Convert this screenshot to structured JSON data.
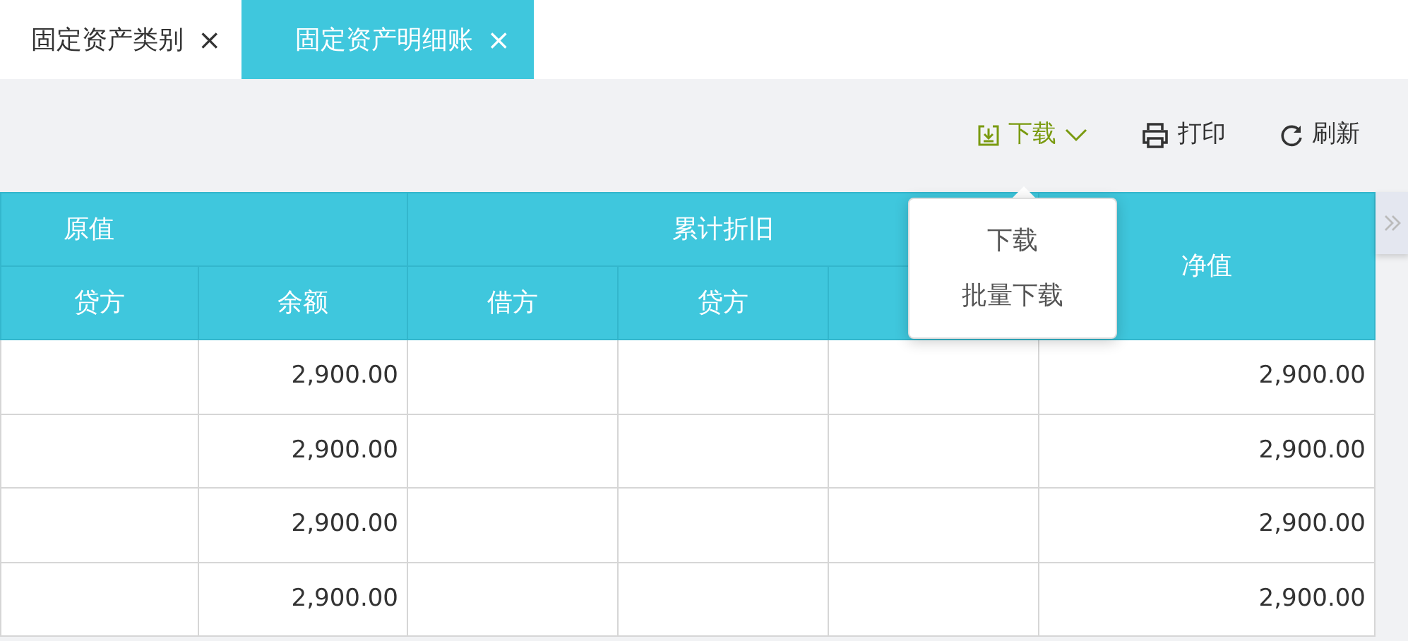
{
  "tabs": [
    {
      "label": "固定资产类别",
      "close": "×",
      "selected": false
    },
    {
      "label": "固定资产明细账",
      "close": "×",
      "selected": true
    }
  ],
  "toolbar": [
    {
      "kind": "download",
      "label": "下载",
      "expanded": true
    },
    {
      "kind": "print",
      "label": "打印"
    },
    {
      "kind": "refresh",
      "label": "刷新"
    }
  ],
  "dropdown": {
    "items": [
      "下载",
      "批量下载"
    ]
  },
  "table": {
    "group_headers": [
      "原值",
      "累计折旧",
      "净值"
    ],
    "subheaders": [
      "贷方",
      "余额",
      "借方",
      "贷方"
    ],
    "rows": [
      {
        "balance": "2,900.00",
        "net_value": "2,900.00"
      },
      {
        "balance": "2,900.00",
        "net_value": "2,900.00"
      },
      {
        "balance": "2,900.00",
        "net_value": "2,900.00"
      },
      {
        "balance": "2,900.00",
        "net_value": "2,900.00"
      }
    ]
  }
}
